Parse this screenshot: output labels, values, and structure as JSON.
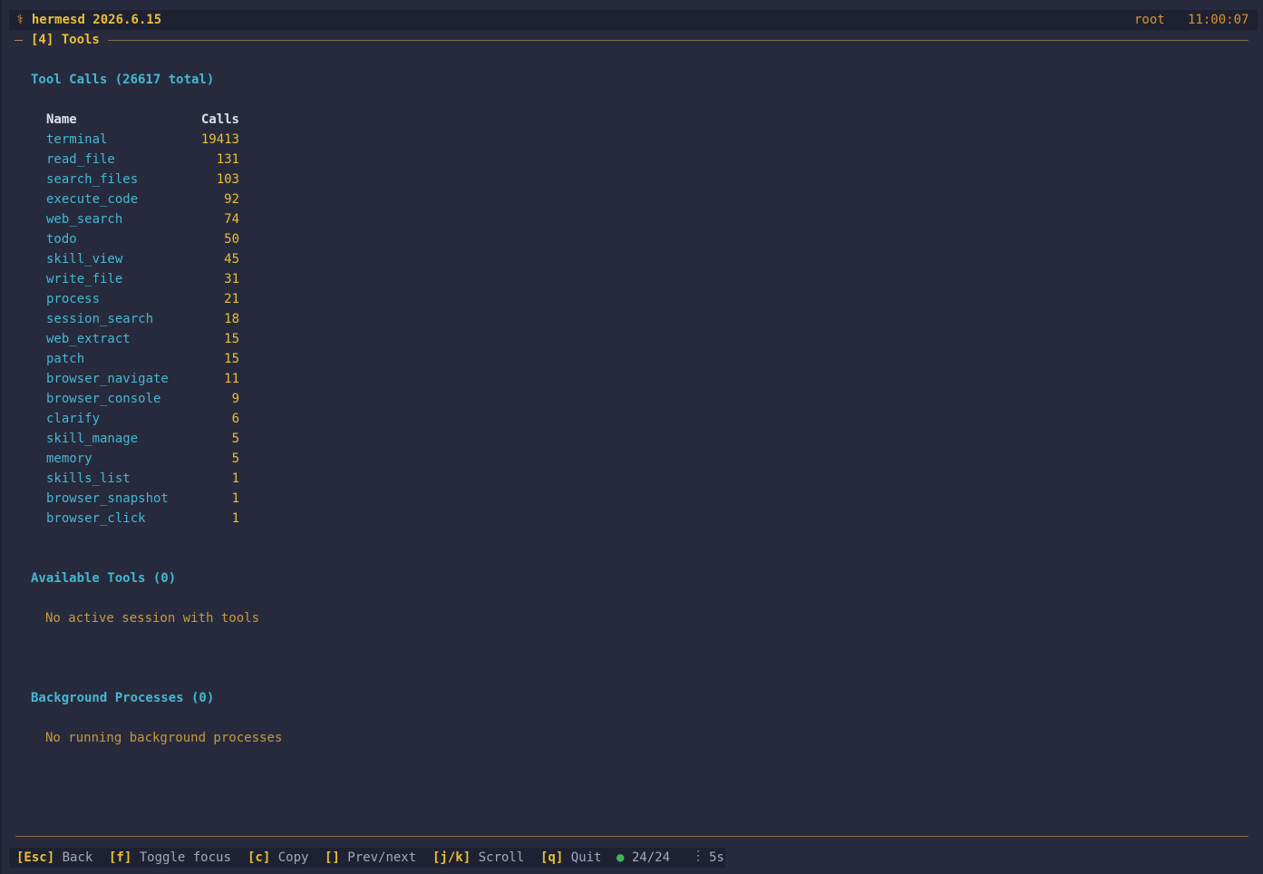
{
  "header": {
    "brand_icon": "⚕",
    "brand": "hermesd 2026.6.15",
    "user": "root",
    "time": "11:00:07"
  },
  "section": {
    "title": "[4] Tools"
  },
  "tool_calls": {
    "heading": "Tool Calls (26617 total)",
    "columns": {
      "name": "Name",
      "calls": "Calls"
    },
    "rows": [
      {
        "name": "terminal",
        "calls": "19413"
      },
      {
        "name": "read_file",
        "calls": "131"
      },
      {
        "name": "search_files",
        "calls": "103"
      },
      {
        "name": "execute_code",
        "calls": "92"
      },
      {
        "name": "web_search",
        "calls": "74"
      },
      {
        "name": "todo",
        "calls": "50"
      },
      {
        "name": "skill_view",
        "calls": "45"
      },
      {
        "name": "write_file",
        "calls": "31"
      },
      {
        "name": "process",
        "calls": "21"
      },
      {
        "name": "session_search",
        "calls": "18"
      },
      {
        "name": "web_extract",
        "calls": "15"
      },
      {
        "name": "patch",
        "calls": "15"
      },
      {
        "name": "browser_navigate",
        "calls": "11"
      },
      {
        "name": "browser_console",
        "calls": "9"
      },
      {
        "name": "clarify",
        "calls": "6"
      },
      {
        "name": "skill_manage",
        "calls": "5"
      },
      {
        "name": "memory",
        "calls": "5"
      },
      {
        "name": "skills_list",
        "calls": "1"
      },
      {
        "name": "browser_snapshot",
        "calls": "1"
      },
      {
        "name": "browser_click",
        "calls": "1"
      }
    ]
  },
  "available_tools": {
    "heading": "Available Tools (0)",
    "empty": "No active session with tools"
  },
  "background": {
    "heading": "Background Processes (0)",
    "empty": "No running background processes"
  },
  "footer": {
    "esc_key": "[Esc]",
    "esc_label": "Back",
    "f_key": "[f]",
    "f_label": "Toggle focus",
    "c_key": "[c]",
    "c_label": "Copy",
    "br_key": "[]",
    "br_label": "Prev/next",
    "jk_key": "[j/k]",
    "jk_label": "Scroll",
    "q_key": "[q]",
    "q_label": "Quit",
    "status_dot": "●",
    "count": "24/24",
    "sep": "⋮",
    "interval": "5s"
  },
  "colors": {
    "background": "#262a3c",
    "accent_yellow": "#e9bf3a",
    "accent_cyan": "#46b7d3",
    "accent_orange": "#d9932f",
    "status_green": "#3fb55a"
  },
  "icons": {
    "brand": "caduceus-icon",
    "status": "status-dot-icon",
    "separator": "vertical-ellipsis-icon"
  }
}
